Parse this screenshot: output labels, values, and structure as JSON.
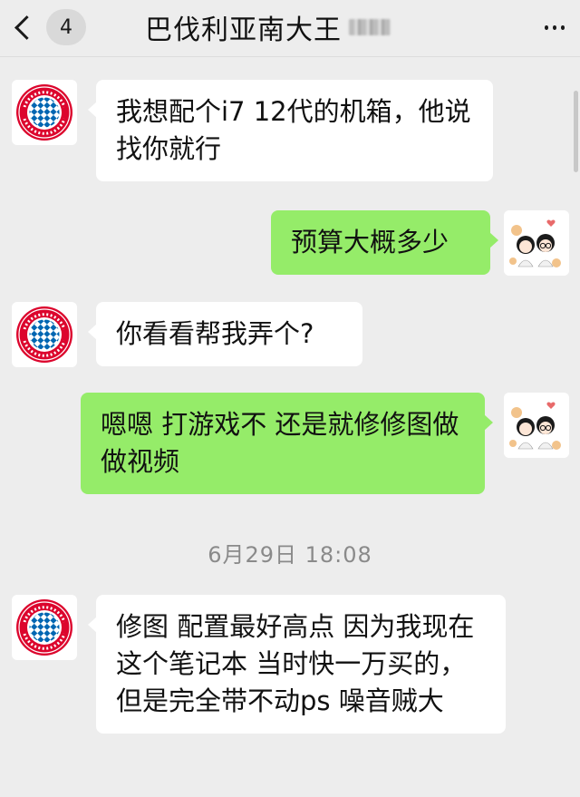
{
  "header": {
    "unread_count": "4",
    "title": "巴伐利亚南大王"
  },
  "timestamp": "6月29日 18:08",
  "messages": [
    {
      "side": "in",
      "text": "我想配个i7 12代的机箱，他说找你就行"
    },
    {
      "side": "out",
      "text": "预算大概多少"
    },
    {
      "side": "in",
      "text": "你看看帮我弄个?"
    },
    {
      "side": "out",
      "text": "嗯嗯 打游戏不 还是就修修图做做视频"
    },
    {
      "side": "in",
      "text": "修图 配置最好高点 因为我现在这个笔记本 当时快一万买的，但是完全带不动ps 噪音贼大"
    }
  ],
  "avatars": {
    "contact": {
      "logo_text": "FC BAYERN MÜNCHEN",
      "colors": {
        "red": "#dc052d",
        "blue": "#0066b2"
      }
    },
    "self": {
      "icon": "couple-cartoon-avatar"
    }
  },
  "colors": {
    "outgoing_bubble": "#95ec69",
    "incoming_bubble": "#ffffff",
    "background": "#ededed"
  }
}
